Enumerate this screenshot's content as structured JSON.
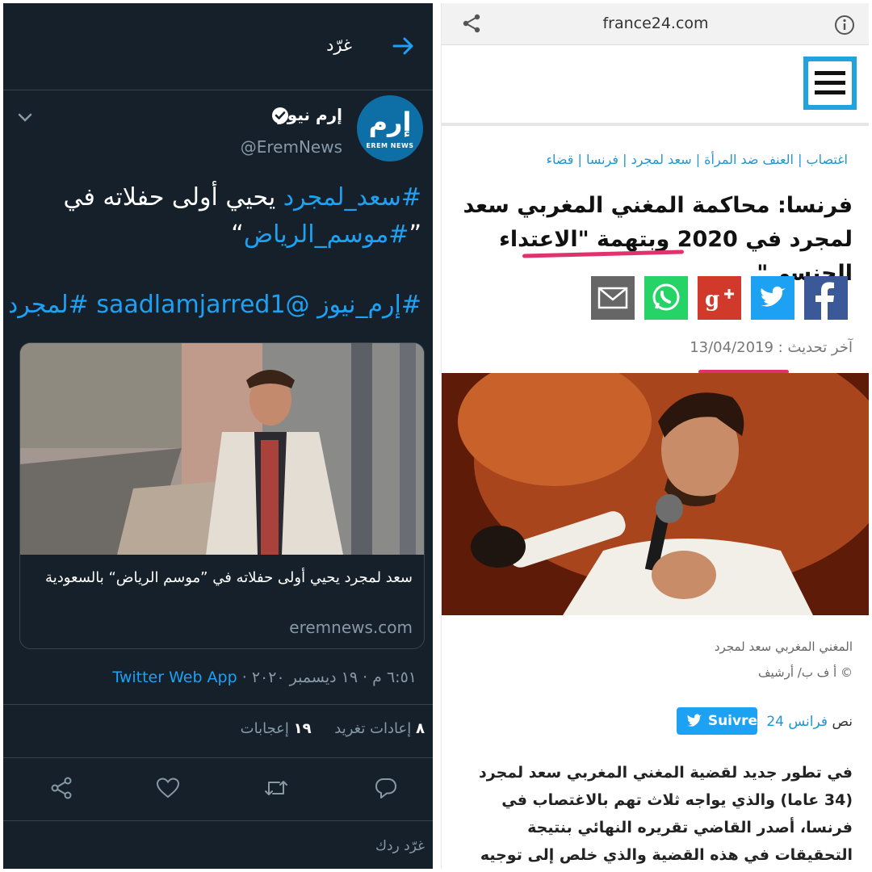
{
  "twitter": {
    "header_title": "غرّد",
    "account_name": "إرم نيوز",
    "account_handle": "@EremNews",
    "avatar_text_ar": "إرم",
    "avatar_text_en": "EREM NEWS",
    "tweet_hashtag_1": "#سعد_لمجرد",
    "tweet_text_1": " يحيي أولى حفلاته في",
    "tweet_hashtag_2": "#موسم_الرياض",
    "tweet_quote_open": "”",
    "tweet_quote_close": "“",
    "tweet_tags": "#إرم_نيوز  @saadlamjarred1 #لمجرد_",
    "card_title": "سعد لمجرد يحيي أولى حفلاته في ”موسم الرياض“ بالسعودية",
    "card_domain": "eremnews.com",
    "timestamp": "٦:٥١ م · ١٩ ديسمبر ٢٠٢٠ · ",
    "source": "Twitter Web App",
    "retweets_count": "٨",
    "retweets_label": "إعادات تغريد",
    "likes_count": "١٩",
    "likes_label": "إعجابات",
    "reply_placeholder": "غرّد ردك",
    "colors": {
      "background": "#15202b",
      "accent": "#1da1f2",
      "muted": "#8899a6"
    },
    "icons": [
      "arrow-right-icon",
      "chevron-down-icon",
      "verified-icon",
      "share-icon",
      "like-icon",
      "retweet-icon",
      "reply-icon"
    ]
  },
  "france24": {
    "browser_domain": "france24.com",
    "categories": "اغتصاب  |  العنف ضد المرأة  |  سعد لمجرد  |  فرنسا  |  قضاء",
    "title": "فرنسا: محاكمة المغني المغربي سعد لمجرد في 2020 وبتهمة \"الاعتداء الجنسي\"",
    "date_label": "آخر تحديث : 13/04/2019",
    "photo_caption": "المغني المغربي سعد لمجرد",
    "photo_credit": "© أ ف ب/ أرشيف",
    "text_by_label": "نص",
    "text_by_link": "فرانس 24",
    "follow_button": "Suivre",
    "body": "في تطور جديد لقضية المغني المغربي سعد لمجرد (34 عاما) والذي يواجه ثلاث تهم بالاغتصاب في فرنسا، أصدر القاضي تقريره النهائي بنتيجة التحقيقات في هذه القضية والذي خلص إلى توجيه تهمة \"الاعتداء الجنسي\"",
    "colors": {
      "link": "#1f97d3",
      "highlight": "#e0336e"
    },
    "icons": [
      "share-icon",
      "info-icon",
      "menu-icon",
      "facebook-icon",
      "twitter-icon",
      "google-plus-icon",
      "whatsapp-icon",
      "email-icon"
    ]
  }
}
